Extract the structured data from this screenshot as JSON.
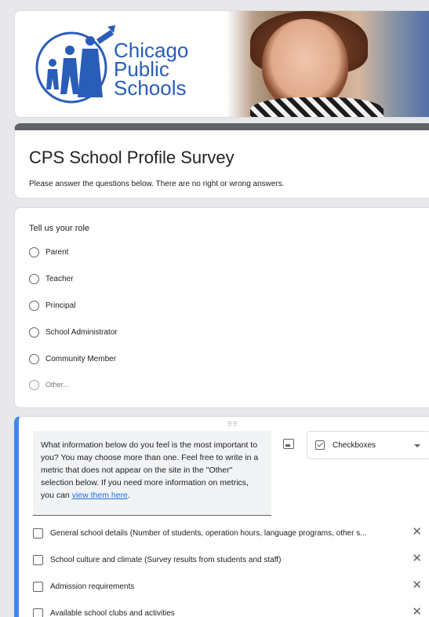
{
  "header": {
    "logo_lines": [
      "Chicago",
      "Public",
      "Schools"
    ]
  },
  "form": {
    "title": "CPS School Profile Survey",
    "description": "Please answer the questions below.  There are no right or wrong answers."
  },
  "role_question": {
    "title": "Tell us your role",
    "options": [
      "Parent",
      "Teacher",
      "Principal",
      "School Administrator",
      "Community Member"
    ],
    "other_label": "Other..."
  },
  "active_question": {
    "text_before_link": "What information below do you feel is the most important to you?  You may choose more than one.  Feel free to write in a metric that does not appear on the site in the \"Other\" selection below.  If you need more information on metrics, you can ",
    "link_text": "view them here",
    "text_after_link": ".",
    "type_label": "Checkboxes",
    "options": [
      "General school details (Number of students, operation hours, language programs, other s...",
      "School culture and climate (Survey results from students and staff)",
      "Admission requirements",
      "Available school clubs and activities"
    ],
    "remove_glyph": "✕"
  },
  "colors": {
    "accent": "#4285f4",
    "title_bar": "#5f6368",
    "logo": "#2a5db8",
    "link": "#1a73e8"
  }
}
